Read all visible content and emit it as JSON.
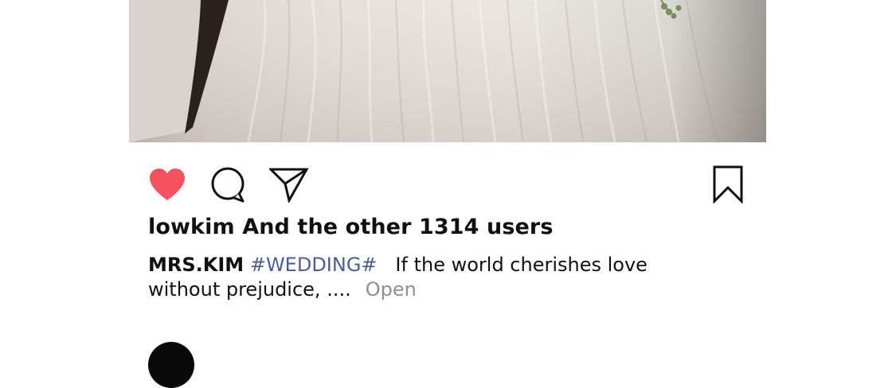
{
  "post": {
    "likes_line": "lowkim And the other 1314 users",
    "caption": {
      "username": "MRS.KIM",
      "hashtag": "#WEDDING#",
      "text": "If the world cherishes love without prejudice, ....",
      "more_label": "Open"
    }
  },
  "icons": {
    "like": "heart-icon",
    "comment": "comment-icon",
    "share": "send-icon",
    "save": "bookmark-icon"
  },
  "colors": {
    "like_active": "#f5515f",
    "hashtag": "#4b5f96",
    "more": "#8f8f8f"
  }
}
